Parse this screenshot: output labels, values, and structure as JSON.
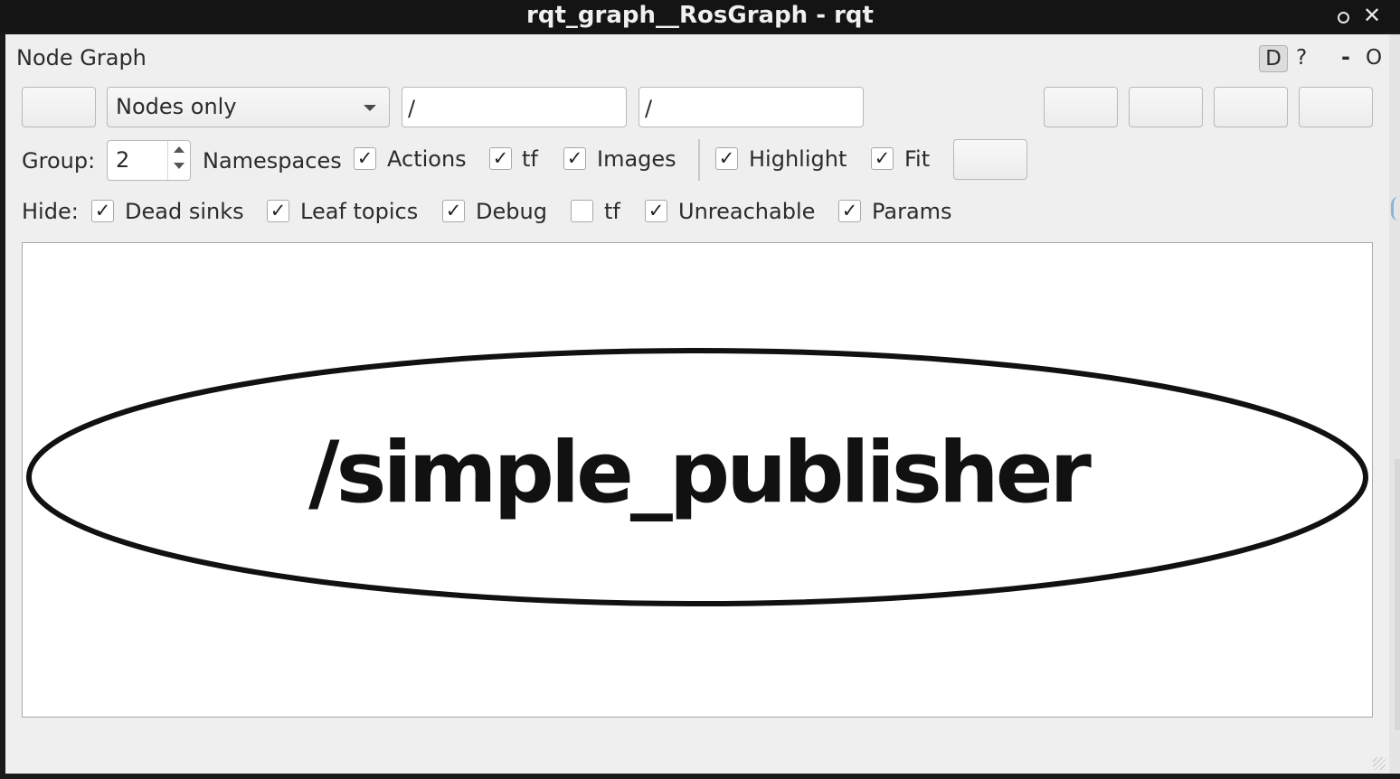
{
  "window": {
    "title": "rqt_graph__RosGraph - rqt"
  },
  "plugin": {
    "title": "Node Graph",
    "d_label": "D",
    "help_label": "?",
    "min_label": "-",
    "float_label": "O"
  },
  "toolbar": {
    "graph_type": "Nodes only",
    "node_filter": "/",
    "topic_filter": "/"
  },
  "group_row": {
    "group_label": "Group:",
    "group_value": "2",
    "namespaces_label": "Namespaces",
    "checkboxes": [
      {
        "label": "Actions",
        "checked": true,
        "mark": "✓"
      },
      {
        "label": "tf",
        "checked": true,
        "mark": "✓"
      },
      {
        "label": "Images",
        "checked": true,
        "mark": "✓"
      },
      {
        "label": "Highlight",
        "checked": true,
        "mark": "✓"
      },
      {
        "label": "Fit",
        "checked": true,
        "mark": "✓"
      }
    ]
  },
  "hide_row": {
    "label": "Hide:",
    "checkboxes": [
      {
        "label": "Dead sinks",
        "checked": true,
        "mark": "✓"
      },
      {
        "label": "Leaf topics",
        "checked": true,
        "mark": "✓"
      },
      {
        "label": "Debug",
        "checked": true,
        "mark": "✓"
      },
      {
        "label": "tf",
        "checked": false,
        "mark": ""
      },
      {
        "label": "Unreachable",
        "checked": true,
        "mark": "✓"
      },
      {
        "label": "Params",
        "checked": true,
        "mark": "✓"
      }
    ]
  },
  "graph": {
    "nodes": [
      {
        "name": "/simple_publisher"
      }
    ]
  }
}
